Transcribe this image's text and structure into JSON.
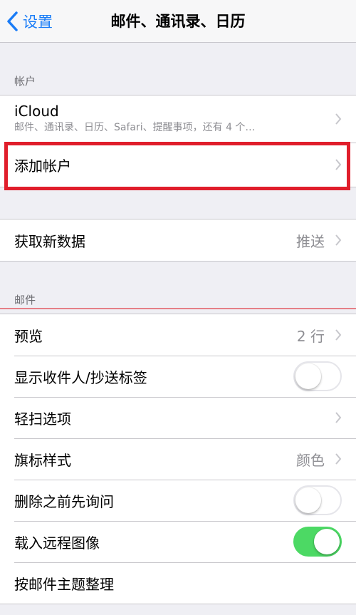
{
  "nav": {
    "back_label": "设置",
    "title": "邮件、通讯录、日历"
  },
  "accounts_section": {
    "header": "帐户",
    "icloud": {
      "label": "iCloud",
      "detail": "邮件、通讯录、日历、Safari、提醒事项，还有 4 个…"
    },
    "add_account": {
      "label": "添加帐户"
    }
  },
  "fetch": {
    "label": "获取新数据",
    "value": "推送"
  },
  "mail_section": {
    "header": "邮件",
    "preview": {
      "label": "预览",
      "value": "2 行"
    },
    "show_to_cc": {
      "label": "显示收件人/抄送标签",
      "on": false
    },
    "swipe_options": {
      "label": "轻扫选项"
    },
    "flag_style": {
      "label": "旗标样式",
      "value": "颜色"
    },
    "ask_before_delete": {
      "label": "删除之前先询问",
      "on": false
    },
    "load_remote_images": {
      "label": "载入远程图像",
      "on": true
    },
    "organize_by_thread": {
      "label": "按邮件主题整理"
    }
  },
  "colors": {
    "accent": "#1a7cf7",
    "toggle_on": "#4cd964",
    "highlight": "#e01e2b"
  }
}
